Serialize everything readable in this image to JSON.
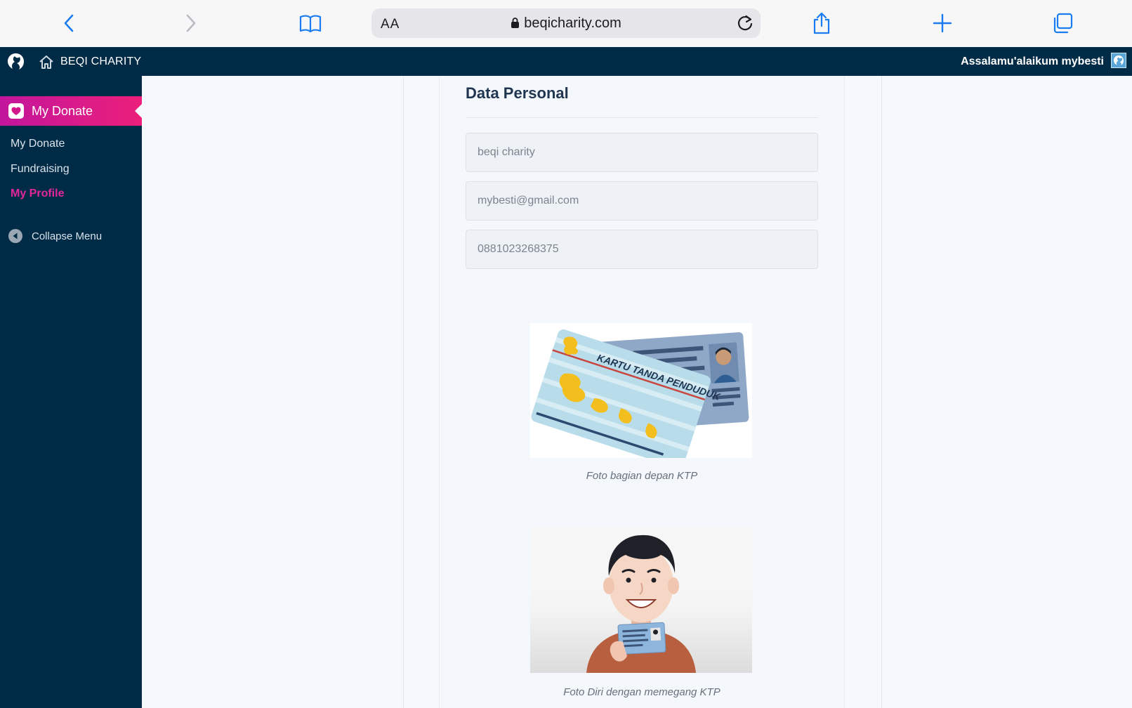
{
  "browser": {
    "text_size_label": "AA",
    "url": "beqicharity.com"
  },
  "app": {
    "brand": "BEQI CHARITY",
    "greeting": "Assalamu'alaikum mybesti"
  },
  "sidebar": {
    "active_section": "My Donate",
    "items": [
      {
        "label": "My Donate",
        "active": false
      },
      {
        "label": "Fundraising",
        "active": false
      },
      {
        "label": "My Profile",
        "active": true
      }
    ],
    "collapse_label": "Collapse Menu"
  },
  "main": {
    "section_title": "Data Personal",
    "fields": {
      "name": "beqi charity",
      "email": "mybesti@gmail.com",
      "phone": "0881023268375"
    },
    "ktp_front": {
      "card_text": "KARTU TANDA PENDUDUK",
      "caption": "Foto bagian depan KTP"
    },
    "selfie": {
      "caption": "Foto Diri dengan memegang KTP"
    }
  },
  "colors": {
    "header_bg": "#002b47",
    "accent_pink": "#e1279b",
    "accent_gradient_end": "#ec1f7a",
    "ios_blue": "#1a7cf0"
  }
}
